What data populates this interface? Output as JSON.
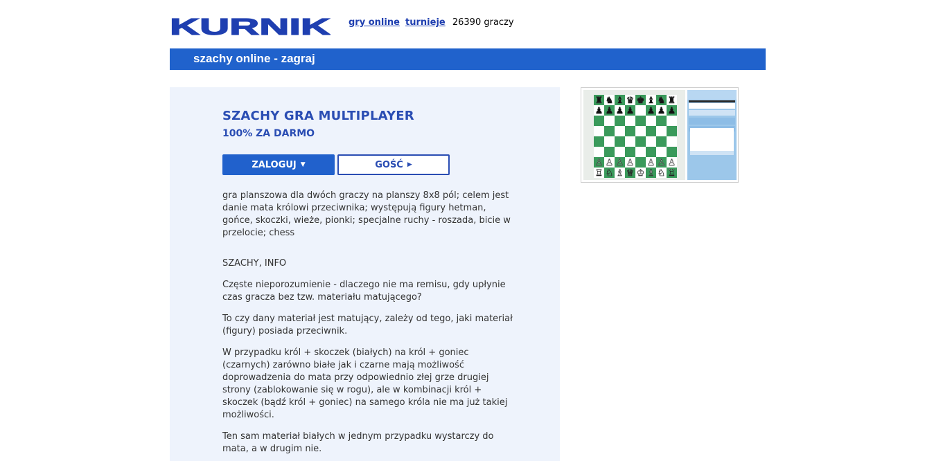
{
  "header": {
    "logo_text": "KURNIK",
    "nav": [
      {
        "label": "gry online"
      },
      {
        "label": "turnieje"
      }
    ],
    "players_count": "26390 graczy"
  },
  "band": {
    "title": "szachy online - zagraj"
  },
  "main": {
    "title": "SZACHY GRA MULTIPLAYER",
    "subtitle": "100% ZA DARMO",
    "login_label": "ZALOGUJ",
    "guest_label": "GOŚĆ",
    "paragraphs": [
      "gra planszowa dla dwóch graczy na planszy 8x8 pól; celem jest danie mata królowi przeciwnika; występują figury hetman, gońce, skoczki, wieże, pionki; specjalne ruchy - roszada, bicie w przelocie; chess",
      "SZACHY, INFO",
      "Częste nieporozumienie - dlaczego nie ma remisu, gdy upłynie czas gracza bez tzw. materiału matującego?",
      "To czy dany materiał jest matujący, zależy od tego, jaki materiał (figury) posiada przeciwnik.",
      "W przypadku król + skoczek (białych) na król + goniec (czarnych) zarówno białe jak i czarne mają możliwość doprowadzenia do mata przy odpowiednio złej grze drugiej strony (zablokowanie się w rogu), ale w kombinacji król + skoczek (bądź król + goniec) na samego króla nie ma już takiej możliwości.",
      "Ten sam materiał białych w jednym przypadku wystarczy do mata, a w drugim nie."
    ]
  },
  "thumbnail": {
    "icon": "chess-game-screenshot",
    "board_dark": "#3a9a5b",
    "board_light": "#ffffff"
  },
  "colors": {
    "brand": "#1f3fb0",
    "band": "#2062cc",
    "panel": "#eef3fc"
  }
}
